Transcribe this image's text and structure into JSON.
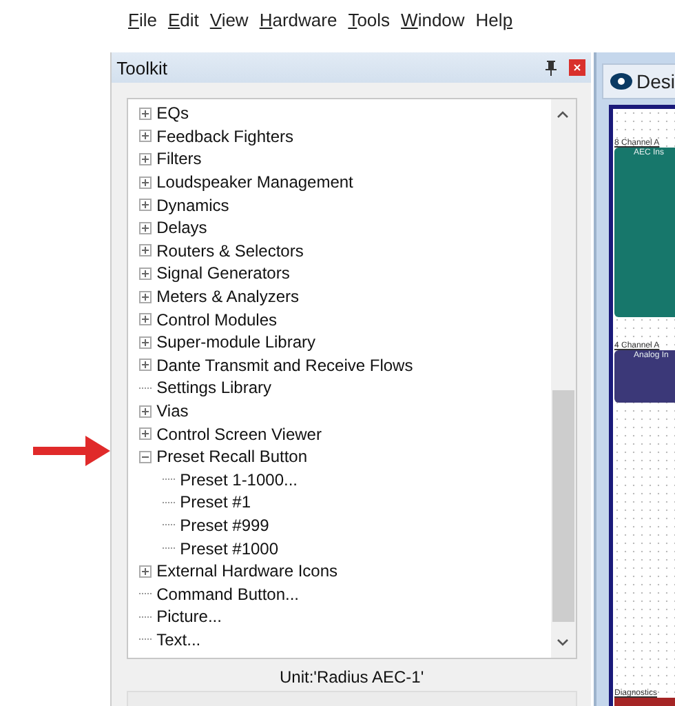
{
  "menu": [
    {
      "key": "F",
      "post": "ile"
    },
    {
      "key": "E",
      "post": "dit"
    },
    {
      "key": "V",
      "post": "iew"
    },
    {
      "key": "H",
      "post": "ardware"
    },
    {
      "key": "T",
      "post": "ools"
    },
    {
      "key": "W",
      "post": "indow"
    },
    {
      "pre": "Hel",
      "key": "p"
    }
  ],
  "toolkit": {
    "title": "Toolkit",
    "tree": [
      {
        "kind": "group",
        "label": "EQs",
        "expanded": false
      },
      {
        "kind": "group",
        "label": "Feedback Fighters",
        "expanded": false
      },
      {
        "kind": "group",
        "label": "Filters",
        "expanded": false
      },
      {
        "kind": "group",
        "label": "Loudspeaker Management",
        "expanded": false
      },
      {
        "kind": "group",
        "label": "Dynamics",
        "expanded": false
      },
      {
        "kind": "group",
        "label": "Delays",
        "expanded": false
      },
      {
        "kind": "group",
        "label": "Routers & Selectors",
        "expanded": false
      },
      {
        "kind": "group",
        "label": "Signal Generators",
        "expanded": false
      },
      {
        "kind": "group",
        "label": "Meters & Analyzers",
        "expanded": false
      },
      {
        "kind": "group",
        "label": "Control Modules",
        "expanded": false
      },
      {
        "kind": "group",
        "label": "Super-module Library",
        "expanded": false
      },
      {
        "kind": "group",
        "label": "Dante Transmit and Receive Flows",
        "expanded": false
      },
      {
        "kind": "leaf",
        "label": "Settings Library"
      },
      {
        "kind": "group",
        "label": "Vias",
        "expanded": false
      },
      {
        "kind": "group",
        "label": "Control Screen Viewer",
        "expanded": false
      },
      {
        "kind": "group",
        "label": "Preset Recall Button",
        "expanded": true,
        "children": [
          {
            "kind": "leaf",
            "label": "Preset 1-1000..."
          },
          {
            "kind": "leaf",
            "label": "Preset #1"
          },
          {
            "kind": "leaf",
            "label": "Preset #999"
          },
          {
            "kind": "leaf",
            "label": "Preset #1000"
          }
        ]
      },
      {
        "kind": "group",
        "label": "External Hardware Icons",
        "expanded": false
      },
      {
        "kind": "leaf",
        "label": "Command Button..."
      },
      {
        "kind": "leaf",
        "label": "Picture..."
      },
      {
        "kind": "leaf",
        "label": "Text..."
      }
    ],
    "unit": "Unit:'Radius AEC-1'"
  },
  "design": {
    "tab": "Desi",
    "blocks": [
      {
        "caption": "8 Channel A",
        "title": "AEC Ins",
        "color": "#17776b"
      },
      {
        "caption": "4 Channel A",
        "title": "Analog In",
        "color": "#3b3878"
      }
    ],
    "footer": {
      "caption": "Diagnostics",
      "color": "#a52525"
    }
  }
}
